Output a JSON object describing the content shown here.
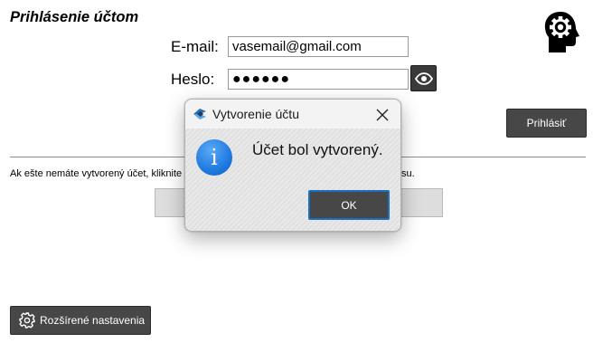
{
  "form": {
    "title": "Prihlásenie účtom",
    "email_label": "E-mail:",
    "email_value": "vasemail@gmail.com",
    "password_label": "Heslo:",
    "password_value": "●●●●●●",
    "login_button": "Prihlásiť"
  },
  "register": {
    "text_start": "Ak ešte nemáte vytvorený účet, kliknite",
    "text_end": "su."
  },
  "footer": {
    "advanced_settings_label": "Rozšírené nastavenia"
  },
  "dialog": {
    "title": "Vytvorenie účtu",
    "message": "Účet bol vytvorený.",
    "ok_label": "OK",
    "info_glyph": "i"
  },
  "colors": {
    "button_dark": "#474747",
    "info_blue": "#1f7ae0",
    "ok_focus_border": "#1a6fc0"
  },
  "icons": {
    "header": "head-gear-icon",
    "password_toggle": "eye-icon",
    "settings": "gear-icon",
    "dialog_app": "app-icon",
    "dialog_close": "close-icon",
    "dialog_info": "info-icon"
  }
}
